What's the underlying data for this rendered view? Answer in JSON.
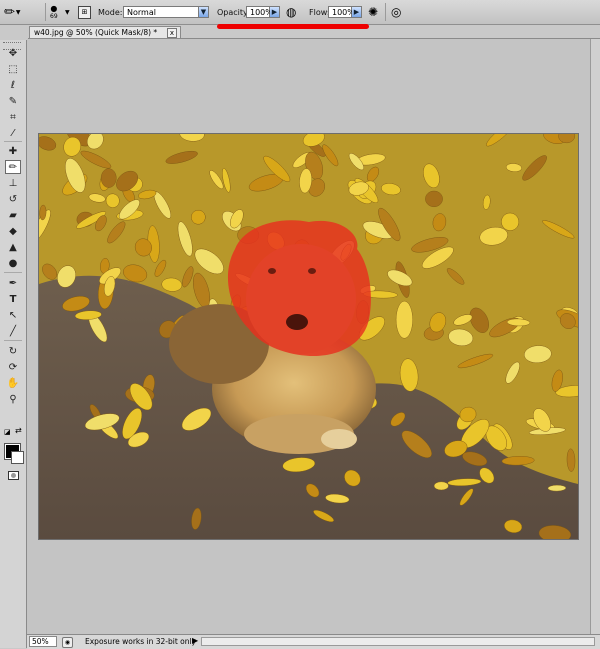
{
  "options_bar": {
    "brush_size": "69",
    "mode_label": "Mode:",
    "mode_value": "Normal",
    "opacity_label": "Opacity:",
    "opacity_value": "100%",
    "flow_label": "Flow:",
    "flow_value": "100%"
  },
  "document": {
    "tab_title": "w40.jpg @ 50% (Quick Mask/8) *",
    "close_glyph": "x"
  },
  "tools": [
    {
      "name": "move-tool-icon",
      "glyph": "✥"
    },
    {
      "name": "marquee-tool-icon",
      "glyph": "⬚"
    },
    {
      "name": "lasso-tool-icon",
      "glyph": "ℓ"
    },
    {
      "name": "quick-selection-tool-icon",
      "glyph": "✎"
    },
    {
      "name": "crop-tool-icon",
      "glyph": "⌗"
    },
    {
      "name": "eyedropper-tool-icon",
      "glyph": "⁄"
    },
    {
      "name": "healing-brush-tool-icon",
      "glyph": "✚"
    },
    {
      "name": "brush-tool-icon",
      "glyph": "✏"
    },
    {
      "name": "clone-stamp-tool-icon",
      "glyph": "⊥"
    },
    {
      "name": "history-brush-tool-icon",
      "glyph": "↺"
    },
    {
      "name": "eraser-tool-icon",
      "glyph": "▰"
    },
    {
      "name": "paint-bucket-tool-icon",
      "glyph": "◆"
    },
    {
      "name": "blur-tool-icon",
      "glyph": "▲"
    },
    {
      "name": "dodge-tool-icon",
      "glyph": "●"
    },
    {
      "name": "pen-tool-icon",
      "glyph": "✒"
    },
    {
      "name": "type-tool-icon",
      "glyph": "T"
    },
    {
      "name": "path-selection-tool-icon",
      "glyph": "↖"
    },
    {
      "name": "line-tool-icon",
      "glyph": "╱"
    },
    {
      "name": "3d-rotate-tool-icon",
      "glyph": "↻"
    },
    {
      "name": "3d-orbit-tool-icon",
      "glyph": "⟳"
    },
    {
      "name": "hand-tool-icon",
      "glyph": "✋"
    },
    {
      "name": "zoom-tool-icon",
      "glyph": "⚲"
    }
  ],
  "status_bar": {
    "zoom": "50%",
    "message": "Exposure works in 32-bit only"
  },
  "colors": {
    "mask_overlay": "#e8301f",
    "red_underline": "#ee0000",
    "foreground": "#000000",
    "background": "#ffffff"
  }
}
